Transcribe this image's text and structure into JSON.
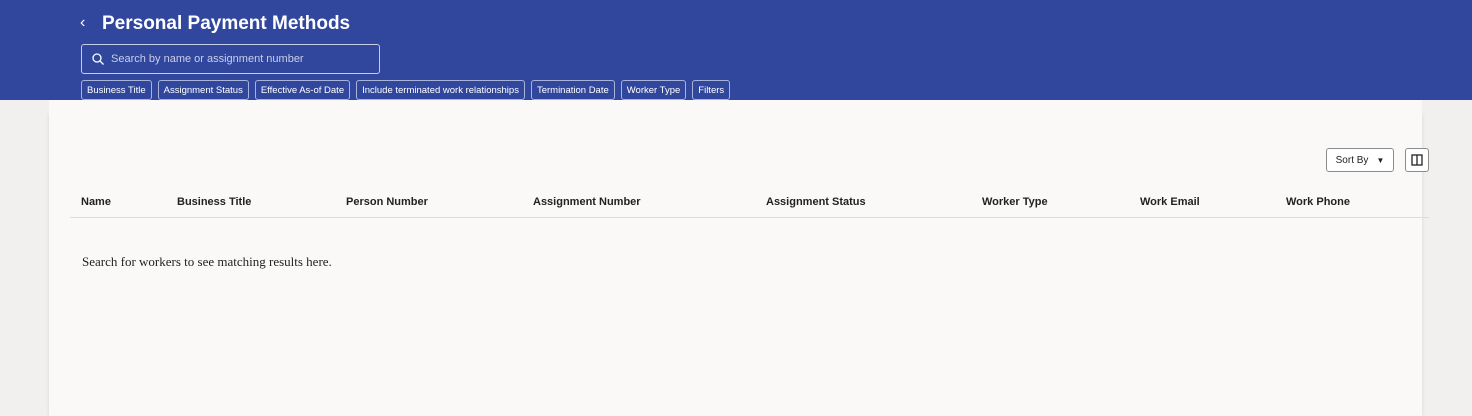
{
  "header": {
    "title": "Personal Payment Methods",
    "search_placeholder": "Search by name or assignment number",
    "chips": [
      "Business Title",
      "Assignment Status",
      "Effective As-of Date",
      "Include terminated work relationships",
      "Termination Date",
      "Worker Type",
      "Filters"
    ]
  },
  "toolbar": {
    "sort_label": "Sort By"
  },
  "table": {
    "columns": [
      "Name",
      "Business Title",
      "Person Number",
      "Assignment Number",
      "Assignment Status",
      "Worker Type",
      "Work Email",
      "Work Phone"
    ],
    "empty_message": "Search for workers to see matching results here."
  }
}
